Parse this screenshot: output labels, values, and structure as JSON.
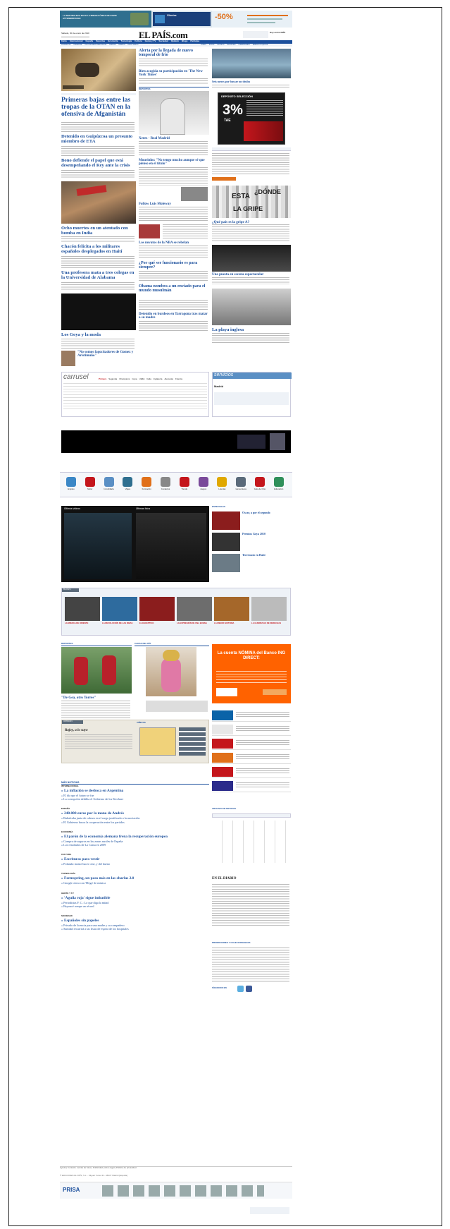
{
  "banner": {
    "left_text": "LA NATURALEZA BAJO LA MIRADA ÚNICA DE DAVID ATTENBOROUGH",
    "center_text": "Clientes",
    "right_big": "-50%",
    "colors": {
      "left_bg": "#2f6f8f",
      "right_bg": "#e8f0f6",
      "accent": "#e0701a"
    }
  },
  "header": {
    "date": "Sábado, 30 de enero de 2010",
    "logo": "EL PAÍS.com",
    "right": "Hoy en EL PAÍS"
  },
  "nav": {
    "items": [
      "Inicio",
      "Internacional",
      "España",
      "Deportes",
      "Economía",
      "Tecnología",
      "Cultura",
      "Gente y TV",
      "Sociedad",
      "Opinión",
      "Blogs",
      "Participa"
    ],
    "sub": [
      "Andalucía",
      "Cataluña",
      "Comunidad Valenciana",
      "Galicia",
      "Madrid",
      "País Vasco"
    ],
    "sub_right": [
      "Vídeo",
      "Fotos",
      "Archivo",
      "Servicios",
      "Clasificados",
      "Edición Impresa"
    ]
  },
  "col1": {
    "lead_title": "Primeras bajas entre las tropas de la OTAN en la ofensiva de Afganistán",
    "h2": "Detenido en Guipúzcoa un presunto miembro de ETA",
    "h3": "Bono defiende el papel que está desempeñando el Rey ante la crisis",
    "h4": "Ocho muertos en un atentado con bomba en India",
    "h5": "Chacón felicita a los militares españoles desplegados en Haití",
    "h6": "Una profesora mata a tres colegas en la Universidad de Alabama",
    "h7": "Los Goya y la moda",
    "quote": "\"No somos fagocitadores de Gomez y Aristimuño\""
  },
  "col2": {
    "h1": "Alerta por la llegada de nuevo temporal de frío",
    "h2": "Bien acogida su participación en 'The New York Times'",
    "section": "DEPORTES",
    "h3": "Xerez - Real Madrid",
    "h4": "Mourinho: \"No tengo mucho aunque sé que pienso en el título\"",
    "h5": "Follow Luis Moleway",
    "h6": "Los novatos de la NBA se rebelan",
    "h7": "¿Por qué ser funcionario es para siempre?",
    "h8": "Obama nombra a un enviado para el mundo musulmán",
    "h9": "Detenido en burdeos en Tarragona tras matar a su madre"
  },
  "col3": {
    "h1": "Seis meses por buscar un títulos",
    "promo_title": "DEPÓSITO SELECCIÓN",
    "promo_pct": "3%",
    "promo_tae": "TAE",
    "h2": "¿Qué país es la gripe A?",
    "h3": "Una puesta en escena espectacular",
    "h4": "La playa inglesa"
  },
  "carrusel": {
    "logo": "carrusel",
    "tabs": [
      "Primera",
      "Segunda",
      "Champions",
      "Copa",
      "UEFA",
      "Italia",
      "Inglaterra",
      "Alemania",
      "Francia"
    ],
    "weather_logo": "servicios",
    "weather_city": "Madrid"
  },
  "services": {
    "labels": [
      "Empleo",
      "Motor",
      "Inmobiliaria",
      "Viajes",
      "Formación",
      "Contactos",
      "Tienda",
      "Juegos",
      "Loterías",
      "Hemeroteca",
      "Guía de Ocio",
      "Educación"
    ]
  },
  "video": {
    "tab1": "Últimos vídeos",
    "tab2": "Últimas fotos",
    "especiales": "ESPECIALES",
    "e1": "Oscar, a por el segundo",
    "e2": "Premios Goya 2010",
    "e3": "Terremoto en Haití"
  },
  "blogs": {
    "title": "BLOGS",
    "items": [
      "LA MIRADA DE ORIENTE",
      "LA REVOLUCIÓN DE LAS IDEAS",
      "EL ESCÉPTICO",
      "LA EXPRESIÓN DE UNA BUENA",
      "LA MEJOR HISTORIA",
      "LA GUERRA ES DE DERECHAS"
    ]
  },
  "lower": {
    "deportes": "DEPORTES",
    "caras": "CARAS DEL DÍA",
    "lead": "\"De Gea, otro Torres\"",
    "opinion": "OPINIÓN",
    "opinion_title": "Rajoy, a lo suyo",
    "vinetas": "VIÑETAS",
    "ing_title": "La cuenta NÓMINA del Banco ING DIRECT:",
    "mas_noticias": "MÁS NOTICIAS",
    "archivo": "ARCHIVO DE NOTICIAS",
    "en_el_diario": "EN EL DIARIO",
    "promos": "PROMOCIONES Y COLECCIONABLES",
    "siguenos": "SÍGUENOS EN"
  },
  "news": [
    {
      "section": "INTERNACIONAL",
      "items": [
        "La inflación se desboca en Argentina",
        "El día que el futuro se fue",
        "La corrupción debilita el Gobierno de los Kirchner"
      ]
    },
    {
      "section": "ESPAÑA",
      "items": [
        "240.000 euros por la mano de Andrés",
        "Rubalcaba junta de cabeza en el cargo justificado a la asociación",
        "El Gobierno busca la cooperación entre los partidos"
      ]
    },
    {
      "section": "ECONOMÍA",
      "items": [
        "El parón de la economía alemana frena la recuperación europea",
        "Compra de seguros en las zonas rurales de España",
        "Los resultados de La Caixa en 2009"
      ]
    },
    {
      "section": "CULTURA",
      "items": [
        "Escrituras para vestir",
        "Polanski insiste hacer cine, y del bueno"
      ]
    },
    {
      "section": "TECNOLOGÍA",
      "items": [
        "Formspring, un paso más en las charlas 2.0",
        "Google cierra con 'Mega' de música"
      ]
    },
    {
      "section": "GENTE Y TV",
      "items": [
        "'Águila roja' sigue imbatible",
        "Periodistas F. C.: Lo que diga la mitad",
        "Beyoncé rompe un récord"
      ]
    },
    {
      "section": "SOCIEDAD",
      "items": [
        "Españoles sin papeles",
        "Privado de licencia para una madre y su compañero",
        "Sanidad recurrirá a las listas de espera de los hospitales"
      ]
    }
  ],
  "footer": {
    "links": "Ayuda | Contacto | Venta de fotos | Publicidad | Aviso legal | Política de privacidad",
    "prisa": "PRISA",
    "copy": "© EDICIONES EL PAÍS, S.L. - Miguel Yuste 40 - 28037 Madrid [España]",
    "colors": {
      "prisa": "#1b4f9c",
      "accent": "#c4161c"
    }
  }
}
